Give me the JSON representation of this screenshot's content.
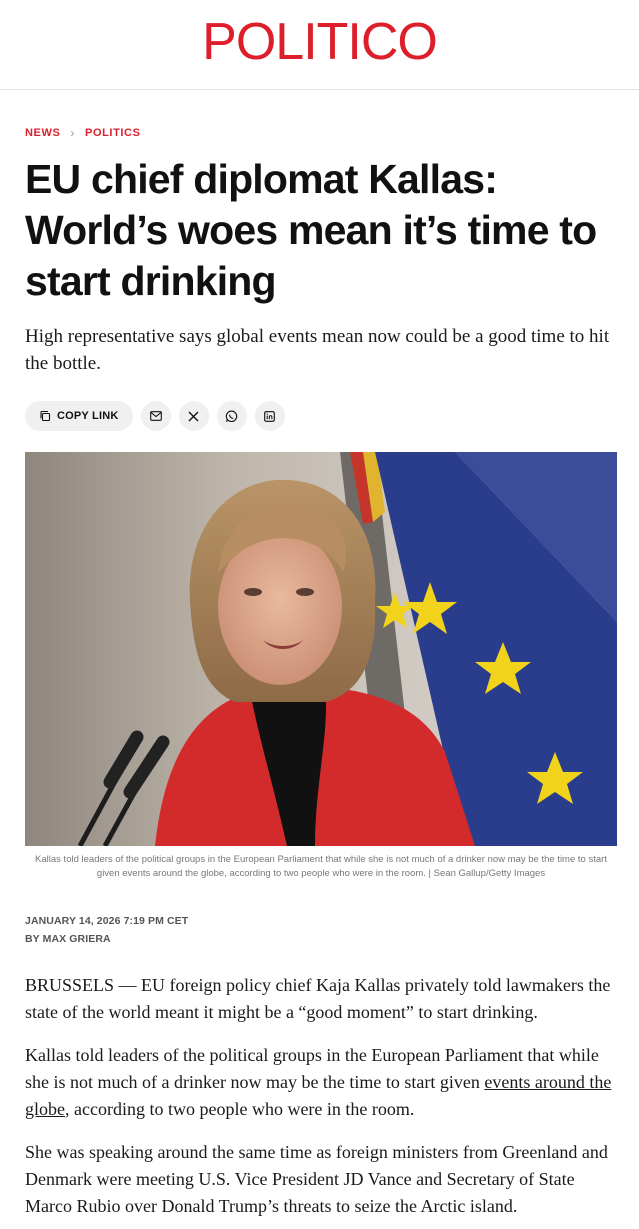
{
  "masthead": {
    "logo": "POLITICO"
  },
  "breadcrumb": {
    "items": [
      "NEWS",
      "POLITICS"
    ]
  },
  "article": {
    "headline": "EU chief diplomat Kallas: World’s woes mean it’s time to start drinking",
    "dek": "High representative says global events mean now could be a good time to hit the bottle.",
    "caption": "Kallas told leaders of the political groups in the European Parliament that while she is not much of a drinker now may be the time to start given events around the globe, according to two people who were in the room. | Sean Gallup/Getty Images",
    "dateline": "JANUARY 14, 2026 7:19 PM CET",
    "byline": "BY MAX GRIERA",
    "p1": "BRUSSELS — EU foreign policy chief Kaja Kallas privately told lawmakers the state of the world meant it might be a “good moment” to start drinking.",
    "p2_before": "Kallas told leaders of the political groups in the European Parliament that while she is not much of a drinker now may be the time to start given ",
    "p2_link": "events around the globe",
    "p2_after": ", according to two people who were in the room.",
    "p3": "She was speaking around the same time as foreign ministers from Greenland and Denmark were meeting U.S. Vice President JD Vance and Secretary of State Marco Rubio over Donald Trump’s threats to seize the Arctic island."
  },
  "share": {
    "copy_label": "COPY LINK",
    "icons": [
      "copy-icon",
      "mail-icon",
      "x-icon",
      "whatsapp-icon",
      "linkedin-icon"
    ]
  },
  "colors": {
    "brand": "#dc1f2b",
    "text": "#111111",
    "muted": "#777777"
  }
}
